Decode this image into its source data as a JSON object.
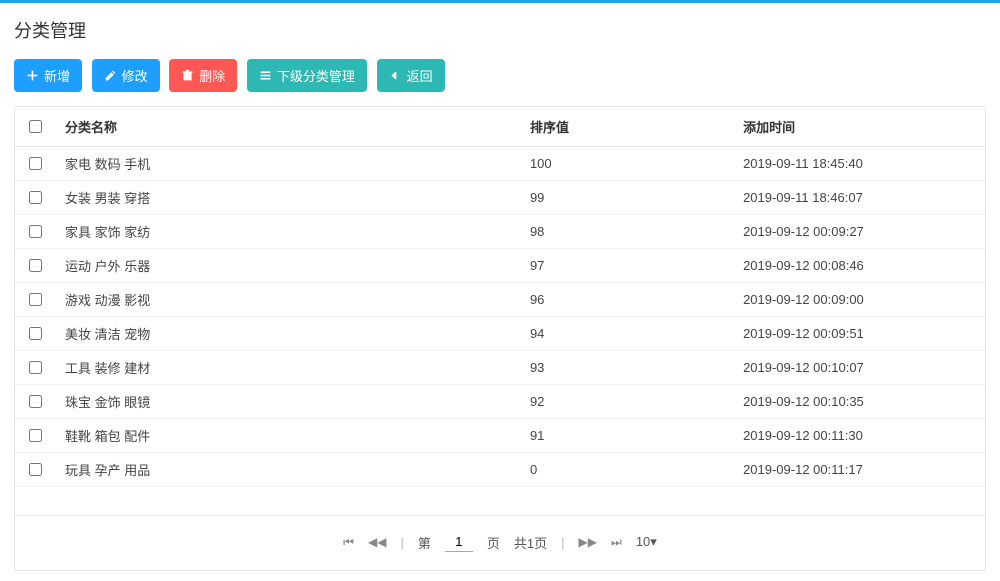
{
  "page_title": "分类管理",
  "toolbar": {
    "add": {
      "label": "新增"
    },
    "edit": {
      "label": "修改"
    },
    "delete": {
      "label": "删除"
    },
    "sub": {
      "label": "下级分类管理"
    },
    "back": {
      "label": "返回"
    }
  },
  "columns": {
    "name": "分类名称",
    "sort": "排序值",
    "time": "添加时间"
  },
  "rows": [
    {
      "name": "家电 数码 手机",
      "sort": "100",
      "time": "2019-09-11 18:45:40"
    },
    {
      "name": "女装 男装 穿搭",
      "sort": "99",
      "time": "2019-09-11 18:46:07"
    },
    {
      "name": "家具 家饰 家纺",
      "sort": "98",
      "time": "2019-09-12 00:09:27"
    },
    {
      "name": "运动 户外 乐器",
      "sort": "97",
      "time": "2019-09-12 00:08:46"
    },
    {
      "name": "游戏 动漫 影视",
      "sort": "96",
      "time": "2019-09-12 00:09:00"
    },
    {
      "name": "美妆 清洁 宠物",
      "sort": "94",
      "time": "2019-09-12 00:09:51"
    },
    {
      "name": "工具 装修 建材",
      "sort": "93",
      "time": "2019-09-12 00:10:07"
    },
    {
      "name": "珠宝 金饰 眼镜",
      "sort": "92",
      "time": "2019-09-12 00:10:35"
    },
    {
      "name": "鞋靴 箱包 配件",
      "sort": "91",
      "time": "2019-09-12 00:11:30"
    },
    {
      "name": "玩具 孕产 用品",
      "sort": "0",
      "time": "2019-09-12 00:11:17"
    }
  ],
  "pagination": {
    "first_icon": "⏮",
    "prev_icon": "◀◀",
    "next_icon": "▶▶",
    "last_icon": "⏭",
    "label_prefix": "第",
    "current": "1",
    "label_page": "页",
    "total_prefix": "共",
    "total_pages": "1",
    "total_suffix": "页",
    "page_size": "10",
    "dropdown_mark": "▾"
  }
}
